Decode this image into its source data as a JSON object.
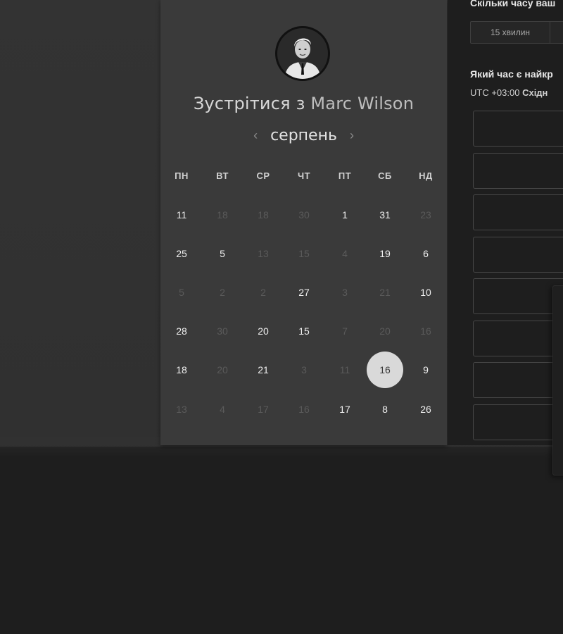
{
  "header": {
    "title_prefix": "Зустрітися з",
    "host_name": "Marc Wilson"
  },
  "calendar": {
    "month": "серпень",
    "prev_icon": "‹",
    "next_icon": "›",
    "weekdays": [
      "ПН",
      "ВТ",
      "СР",
      "ЧТ",
      "ПТ",
      "СБ",
      "НД"
    ],
    "weeks": [
      [
        {
          "d": "11",
          "active": true
        },
        {
          "d": "18",
          "active": false
        },
        {
          "d": "18",
          "active": false
        },
        {
          "d": "30",
          "active": false
        },
        {
          "d": "1",
          "active": true
        },
        {
          "d": "31",
          "active": true
        },
        {
          "d": "23",
          "active": false
        }
      ],
      [
        {
          "d": "25",
          "active": true
        },
        {
          "d": "5",
          "active": true
        },
        {
          "d": "13",
          "active": false
        },
        {
          "d": "15",
          "active": false
        },
        {
          "d": "4",
          "active": false
        },
        {
          "d": "19",
          "active": true
        },
        {
          "d": "6",
          "active": true
        }
      ],
      [
        {
          "d": "5",
          "active": false
        },
        {
          "d": "2",
          "active": false
        },
        {
          "d": "2",
          "active": false
        },
        {
          "d": "27",
          "active": true
        },
        {
          "d": "3",
          "active": false
        },
        {
          "d": "21",
          "active": false
        },
        {
          "d": "10",
          "active": true
        }
      ],
      [
        {
          "d": "28",
          "active": true
        },
        {
          "d": "30",
          "active": false
        },
        {
          "d": "20",
          "active": true
        },
        {
          "d": "15",
          "active": true
        },
        {
          "d": "7",
          "active": false
        },
        {
          "d": "20",
          "active": false
        },
        {
          "d": "16",
          "active": false
        }
      ],
      [
        {
          "d": "18",
          "active": true
        },
        {
          "d": "20",
          "active": false
        },
        {
          "d": "21",
          "active": true
        },
        {
          "d": "3",
          "active": false
        },
        {
          "d": "11",
          "active": false
        },
        {
          "d": "16",
          "active": true,
          "selected": true
        },
        {
          "d": "9",
          "active": true
        }
      ],
      [
        {
          "d": "13",
          "active": false
        },
        {
          "d": "4",
          "active": false
        },
        {
          "d": "17",
          "active": false
        },
        {
          "d": "16",
          "active": false
        },
        {
          "d": "17",
          "active": true
        },
        {
          "d": "8",
          "active": true
        },
        {
          "d": "26",
          "active": true
        }
      ]
    ]
  },
  "booking": {
    "duration_question": "Скільки часу ваш",
    "duration_option": "15 хвилин",
    "time_question": "Який час є найкр",
    "timezone_offset": "UTC +03:00",
    "timezone_name": "Східн",
    "slot_count": 8
  }
}
